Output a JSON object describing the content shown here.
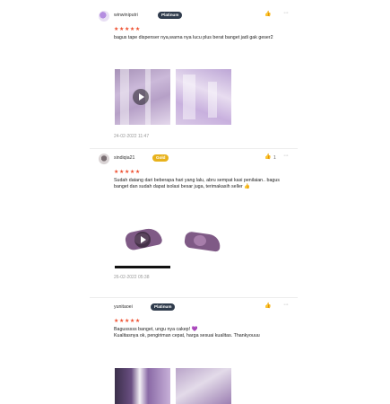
{
  "reviews": [
    {
      "username": "winwiniputri",
      "badge": "Platinum",
      "like_count": "",
      "stars": "★★★★★",
      "text": "bagus tape dispenser nya,warna nya lucu plus berat banget jadi gak geser2",
      "date": "24-02-2022 11:47"
    },
    {
      "username": "sindiqia21",
      "badge": "Gold",
      "like_count": "1",
      "stars": "★★★★★",
      "text": "Sudah datang dari beberapa hari yang lalu, abru sempat kasi penilaian.. bagus banget dan sudah dapat isolasi besar juga, terimakasih seller",
      "date": "26-02-2022 05:38"
    },
    {
      "username": "yunitaoei",
      "badge": "Platinum",
      "like_count": "",
      "stars": "★★★★★",
      "text": "Bagusssss banget, ungu nya cakep!",
      "text2": "Kualitasnya ok, pengiriman cepat, harga sesuai kualitas. Thankyouuu",
      "date": ""
    }
  ],
  "icons": {
    "like": "👍",
    "more": "···",
    "thumbs_up_emoji": "👍",
    "heart_emoji": "💜"
  },
  "colors": {
    "star": "#ee4d2d",
    "platinum_badge": "#2f3b4c",
    "gold_badge": "#e8b21c"
  }
}
